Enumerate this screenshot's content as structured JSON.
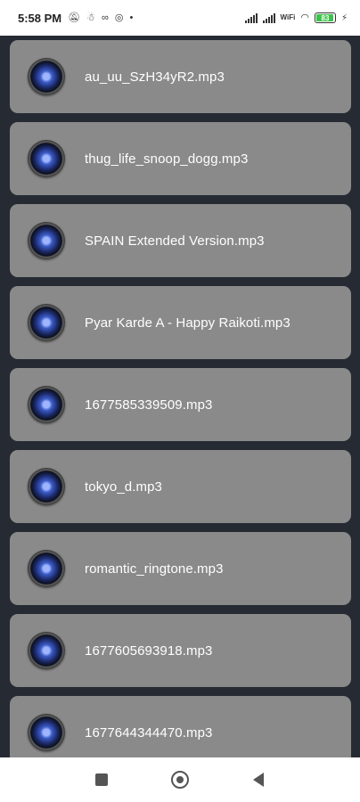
{
  "status_bar": {
    "time": "5:58 PM",
    "battery_level": "83",
    "wifi_label": "WiFi",
    "icons": [
      "muted-alarm-icon",
      "notification-icon",
      "data-icon",
      "sync-icon",
      "dot-icon"
    ]
  },
  "songs": [
    {
      "name": "au_uu_SzH34yR2.mp3"
    },
    {
      "name": "thug_life_snoop_dogg.mp3"
    },
    {
      "name": "SPAIN Extended Version.mp3"
    },
    {
      "name": "Pyar Karde A - Happy Raikoti.mp3"
    },
    {
      "name": "1677585339509.mp3"
    },
    {
      "name": "tokyo_d.mp3"
    },
    {
      "name": "romantic_ringtone.mp3"
    },
    {
      "name": "1677605693918.mp3"
    },
    {
      "name": "1677644344470.mp3"
    }
  ],
  "colors": {
    "background": "#262b33",
    "card": "#8a8a8a",
    "text": "#ffffff",
    "battery": "#3cc24a"
  },
  "nav": {
    "recents_icon": "square-icon",
    "home_icon": "circle-icon",
    "back_icon": "triangle-back-icon"
  }
}
